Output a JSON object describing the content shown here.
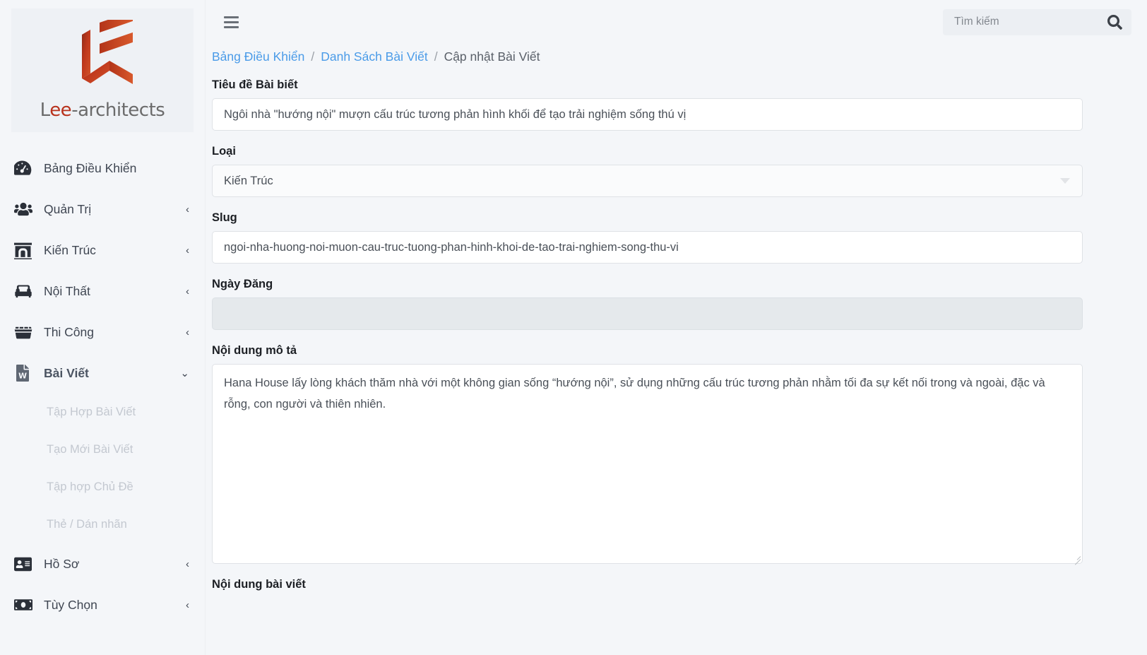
{
  "brand": {
    "logo_text_plain": "L",
    "logo_text_red": "ee",
    "logo_text_rest": "-architects",
    "logo_full": "Lee-architects",
    "accent_color": "#b8321c"
  },
  "sidebar": {
    "items": [
      {
        "label": "Bảng Điều Khiển",
        "icon": "dashboard-gauge-icon",
        "caret": "",
        "active": false
      },
      {
        "label": "Quản Trị",
        "icon": "users-icon",
        "caret": "‹",
        "active": false
      },
      {
        "label": "Kiến Trúc",
        "icon": "archway-icon",
        "caret": "‹",
        "active": false
      },
      {
        "label": "Nội Thất",
        "icon": "couch-icon",
        "caret": "‹",
        "active": false
      },
      {
        "label": "Thi Công",
        "icon": "dumpster-icon",
        "caret": "‹",
        "active": false
      },
      {
        "label": "Bài Viết",
        "icon": "word-file-icon",
        "caret": "⌄",
        "active": true
      },
      {
        "label": "Hồ Sơ",
        "icon": "id-card-icon",
        "caret": "‹",
        "active": false
      },
      {
        "label": "Tùy Chọn",
        "icon": "money-bill-icon",
        "caret": "‹",
        "active": false
      }
    ],
    "submenu": [
      {
        "label": "Tập Hợp Bài Viết"
      },
      {
        "label": "Tạo Mới Bài Viết"
      },
      {
        "label": "Tập hợp Chủ Đề"
      },
      {
        "label": "Thẻ / Dán nhãn"
      }
    ]
  },
  "topbar": {
    "menu_toggle_icon": "hamburger-icon",
    "search": {
      "placeholder": "Tìm kiếm",
      "value": "",
      "icon": "search-icon"
    }
  },
  "breadcrumb": {
    "items": [
      {
        "label": "Bảng Điều Khiển",
        "link": true
      },
      {
        "label": "Danh Sách Bài Viết",
        "link": true
      },
      {
        "label": "Cập nhật Bài Viết",
        "link": false
      }
    ],
    "separator": "/"
  },
  "form": {
    "title_field": {
      "label": "Tiêu đề Bài biết",
      "value": "Ngôi nhà \"hướng nội\" mượn cấu trúc tương phản hình khối để tạo trải nghiệm sống thú vị",
      "placeholder": ""
    },
    "category_field": {
      "label": "Loại",
      "value": "Kiến Trúc",
      "icon": "chevron-down-icon"
    },
    "slug_field": {
      "label": "Slug",
      "value": "ngoi-nha-huong-noi-muon-cau-truc-tuong-phan-hinh-khoi-de-tao-trai-nghiem-song-thu-vi",
      "placeholder": ""
    },
    "date_field": {
      "label": "Ngày Đăng",
      "value": "",
      "placeholder": "",
      "disabled": true
    },
    "description_field": {
      "label": "Nội dung mô tả",
      "value": "Hana House lấy lòng khách thăm nhà với một không gian sống “hướng nội”, sử dụng những cấu trúc tương phản nhằm tối đa sự kết nối trong và ngoài, đặc và rỗng, con người và thiên nhiên.",
      "placeholder": ""
    },
    "body_field": {
      "label": "Nội dung bài viết"
    }
  }
}
